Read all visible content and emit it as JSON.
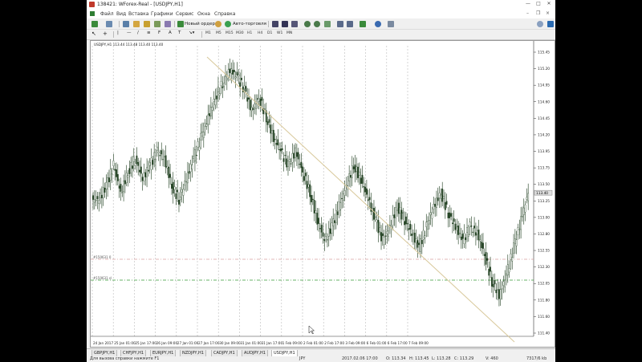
{
  "window": {
    "title": "138421: WForex-Real - [USDJPY,H1]",
    "controls": [
      "—",
      "□",
      "✕"
    ]
  },
  "menu": {
    "items": [
      "Файл",
      "Вид",
      "Вставка",
      "Графики",
      "Сервис",
      "Окна",
      "Справка"
    ]
  },
  "toolbar": {
    "new_order": "Новый ордер",
    "autotrading": "Авто-торговля",
    "timeframes": [
      "M1",
      "M5",
      "M15",
      "M30",
      "H1",
      "H4",
      "D1",
      "W1",
      "MN"
    ],
    "active_timeframe": "H1"
  },
  "chart": {
    "info": "USDJPY,H1 113.44 113.48 113.40 113.40",
    "level_labels": [
      "#150631 0",
      "#150631 sl"
    ],
    "price_labels": [
      "115.45",
      "115.20",
      "114.95",
      "114.60",
      "114.45",
      "114.20",
      "113.95",
      "113.75",
      "113.50",
      "113.25",
      "113.00",
      "112.80",
      "112.55",
      "112.30",
      "112.05",
      "111.80",
      "111.60",
      "111.40"
    ],
    "price_current": "113.40",
    "time_labels": [
      "24 Jan 2017",
      "25 Jan 01:00",
      "25 Jan 17:00",
      "26 Jan 09:00",
      "27 Jan 01:00",
      "27 Jan 17:00",
      "30 Jan 09:00",
      "31 Jan 01:00",
      "31 Jan 17:00",
      "1 Feb 09:00",
      "2 Feb 01:00",
      "2 Feb 17:00",
      "3 Feb 09:00",
      "6 Feb 01:00",
      "6 Feb 17:00",
      "7 Feb 09:00"
    ],
    "candle_color": "#1a3a1a",
    "trend_color": "#d8c89a",
    "level_red_color": "#d9a0a0",
    "level_green_color": "#3a9a3a"
  },
  "chart_data": {
    "type": "candlestick",
    "title": "USDJPY,H1",
    "ylim": [
      111.3,
      115.55
    ],
    "close_series": [
      113.3,
      113.5,
      113.8,
      113.4,
      113.7,
      113.9,
      113.6,
      113.8,
      114.0,
      113.9,
      113.5,
      113.3,
      113.6,
      113.9,
      114.2,
      114.5,
      114.8,
      115.0,
      115.2,
      115.1,
      114.9,
      114.6,
      114.8,
      114.5,
      114.2,
      114.0,
      113.8,
      114.0,
      113.7,
      113.4,
      113.0,
      112.7,
      112.9,
      113.2,
      113.5,
      113.8,
      113.6,
      113.3,
      113.0,
      112.7,
      112.9,
      113.2,
      113.0,
      112.8,
      112.6,
      112.9,
      113.2,
      113.4,
      113.1,
      112.9,
      112.7,
      112.9,
      112.8,
      112.5,
      112.1,
      111.9,
      112.2,
      112.6,
      113.0,
      113.4
    ]
  },
  "tabs": {
    "items": [
      "GBPJPY,H1",
      "CHFJPY,H1",
      "EURJPY,H1",
      "NZDJPY,H1",
      "CADJPY,H1",
      "AUDJPY,H1",
      "USDJPY,H1"
    ],
    "active": "USDJPY,H1"
  },
  "status": {
    "help": "Для вызова справки нажмите F1",
    "symbol": "JPY",
    "time": "2017.02.06 17:00",
    "open": "O: 113.34",
    "high": "H: 113.45",
    "low": "L: 113.28",
    "close": "C: 113.29",
    "volume": "V: 460",
    "traffic": "7317/6 kb"
  }
}
